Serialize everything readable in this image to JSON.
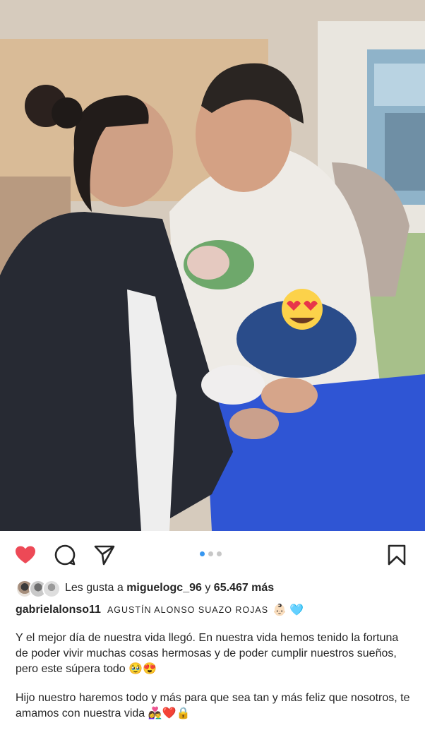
{
  "post": {
    "likes": {
      "prefix": "Les gusta a",
      "user": "miguelogc_96",
      "joiner": "y",
      "count": "65.467 más"
    },
    "author": {
      "username": "gabrielalonso11",
      "full_name": "AGUSTÍN ALONSO SUAZO ROJAS",
      "emojis": "👶🏻 🩵"
    },
    "caption": [
      "Y el mejor día de nuestra vida llegó. En nuestra vida hemos tenido la fortuna de poder vivir muchas cosas hermosas y de poder cumplir nuestros sueños, pero este súpera todo 🥹😍",
      "Hijo nuestro haremos todo y más para que sea tan y más feliz que nosotros, te amamos con nuestra vida 👩‍❤️‍👨❤️🔒"
    ],
    "carousel": {
      "total": 3,
      "current": 1
    },
    "icons": {
      "like": "heart-filled-icon",
      "comment": "comment-bubble-icon",
      "share": "paper-plane-icon",
      "save": "bookmark-icon"
    },
    "colors": {
      "like": "#ed4956",
      "dot_active": "#3897f0",
      "dot_inactive": "#c7c7c7"
    }
  }
}
